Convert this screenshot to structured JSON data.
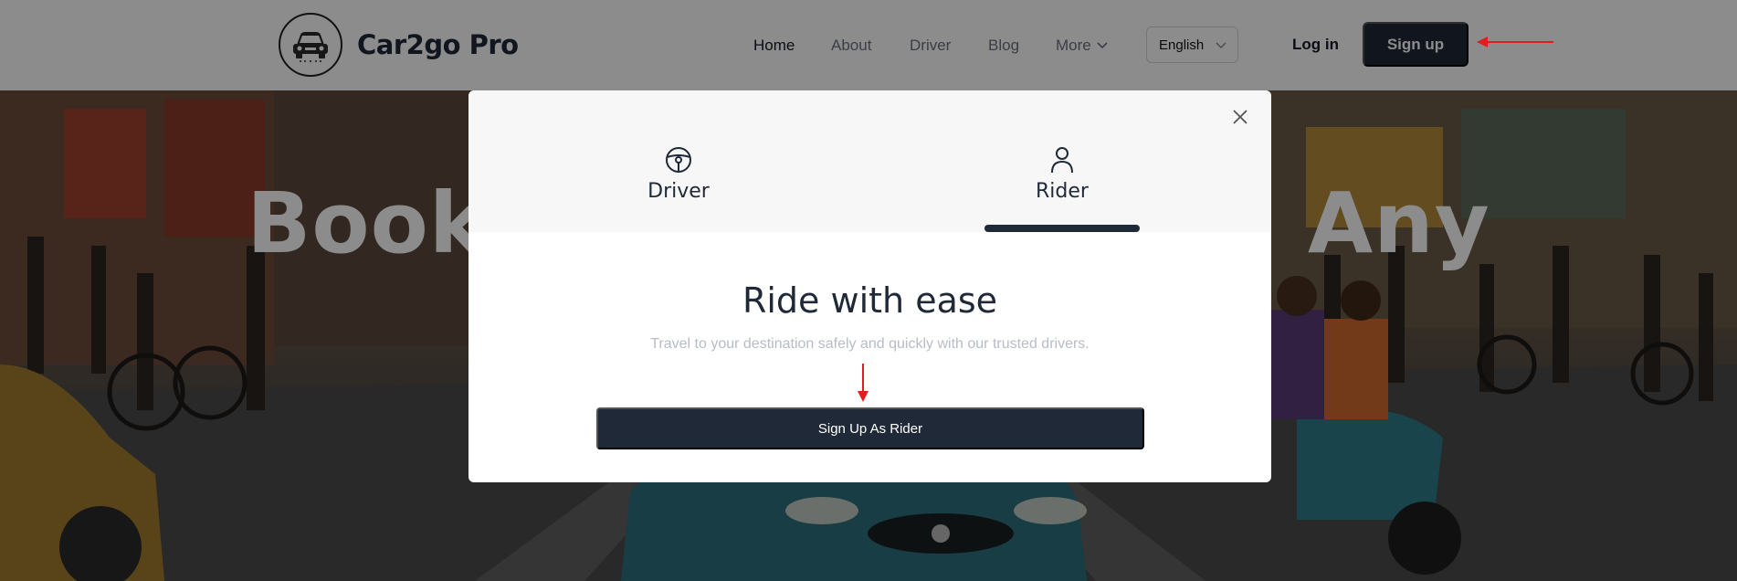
{
  "header": {
    "brand": "Car2go Pro",
    "nav": [
      {
        "label": "Home",
        "active": true
      },
      {
        "label": "About",
        "active": false
      },
      {
        "label": "Driver",
        "active": false
      },
      {
        "label": "Blog",
        "active": false
      },
      {
        "label": "More",
        "active": false
      }
    ],
    "language": "English",
    "login_label": "Log in",
    "signup_label": "Sign up"
  },
  "hero": {
    "title_left": "Book",
    "title_right": "Any"
  },
  "modal": {
    "tabs": [
      {
        "label": "Driver",
        "icon": "steering-wheel-icon",
        "selected": false
      },
      {
        "label": "Rider",
        "icon": "user-icon",
        "selected": true
      }
    ],
    "heading": "Ride with ease",
    "subtitle": "Travel to your destination safely and quickly with our trusted drivers.",
    "cta_label": "Sign Up As Rider"
  },
  "colors": {
    "primary": "#1f2937",
    "annotation": "#e11d1d",
    "muted_text": "#b7bcc6"
  }
}
